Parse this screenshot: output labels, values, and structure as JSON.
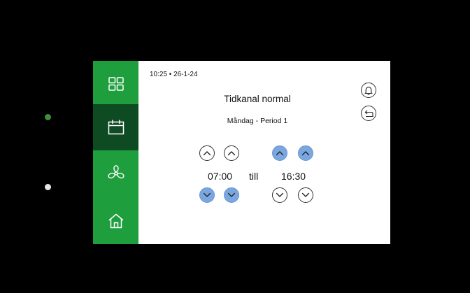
{
  "device": {
    "indicators": [
      {
        "name": "status-led-green",
        "color": "#3f8f3f"
      },
      {
        "name": "status-led-white",
        "color": "#e6e6e6"
      }
    ]
  },
  "sidebar": {
    "items": [
      {
        "icon": "grid-icon",
        "active": false
      },
      {
        "icon": "calendar-icon",
        "active": true
      },
      {
        "icon": "fan-icon",
        "active": false
      },
      {
        "icon": "home-icon",
        "active": false
      }
    ],
    "accent": "#1e9e3d",
    "active_color": "#0e4a22"
  },
  "header": {
    "datetime": "10:25 • 26-1-24",
    "icons": [
      "bell-icon",
      "back-icon"
    ]
  },
  "main": {
    "title": "Tidkanal normal",
    "subtitle": "Måndag - Period 1",
    "start_time": "07:00",
    "separator": "till",
    "end_time": "16:30",
    "highlight_color": "#7ba7e0"
  }
}
